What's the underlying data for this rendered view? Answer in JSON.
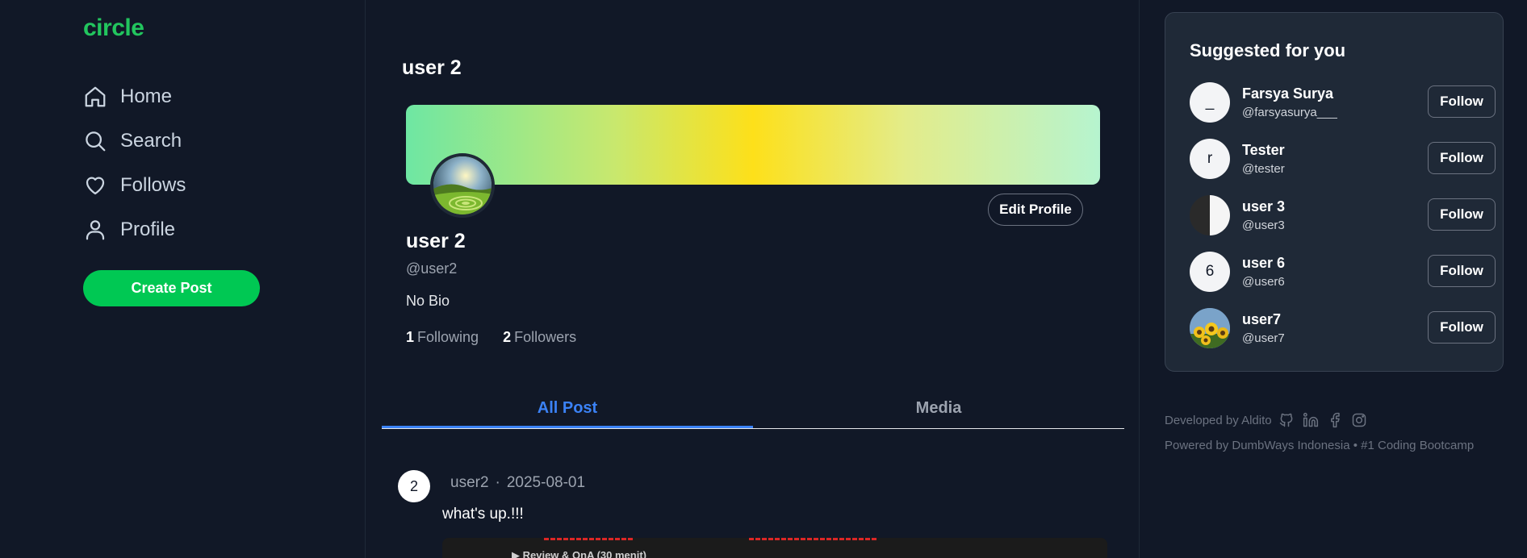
{
  "app": {
    "logo": "circle"
  },
  "sidebar": {
    "items": [
      {
        "label": "Home",
        "icon": "home-icon"
      },
      {
        "label": "Search",
        "icon": "search-icon"
      },
      {
        "label": "Follows",
        "icon": "heart-icon"
      },
      {
        "label": "Profile",
        "icon": "user-icon"
      }
    ],
    "create_post_label": "Create Post"
  },
  "profile": {
    "page_title": "user 2",
    "name": "user 2",
    "handle": "@user2",
    "bio": "No Bio",
    "following_count": "1",
    "following_label": "Following",
    "followers_count": "2",
    "followers_label": "Followers",
    "edit_label": "Edit Profile"
  },
  "tabs": [
    {
      "label": "All Post",
      "active": true
    },
    {
      "label": "Media",
      "active": false
    }
  ],
  "post": {
    "avatar_text": "2",
    "author": "user2",
    "separator": "·",
    "date": "2025-08-01",
    "text": "what's up.!!!",
    "image_caption": "▶ Review & QnA (30 menit)"
  },
  "suggestions": {
    "title": "Suggested for you",
    "follow_label": "Follow",
    "users": [
      {
        "name": "Farsya Surya",
        "handle": "@farsyasurya___",
        "avatar_text": "_"
      },
      {
        "name": "Tester",
        "handle": "@tester",
        "avatar_text": "r"
      },
      {
        "name": "user 3",
        "handle": "@user3",
        "avatar_text": ""
      },
      {
        "name": "user 6",
        "handle": "@user6",
        "avatar_text": "6"
      },
      {
        "name": "user7",
        "handle": "@user7",
        "avatar_text": ""
      }
    ]
  },
  "footer": {
    "developed_by": "Developed by Aldito",
    "powered_by": "Powered by DumbWays Indonesia • #1 Coding Bootcamp",
    "icons": [
      "github-icon",
      "linkedin-icon",
      "facebook-icon",
      "instagram-icon"
    ]
  },
  "colors": {
    "background": "#111827",
    "brand_green": "#22c55e",
    "create_button": "#00c853",
    "active_tab": "#3b82f6",
    "card": "#1f2937"
  }
}
